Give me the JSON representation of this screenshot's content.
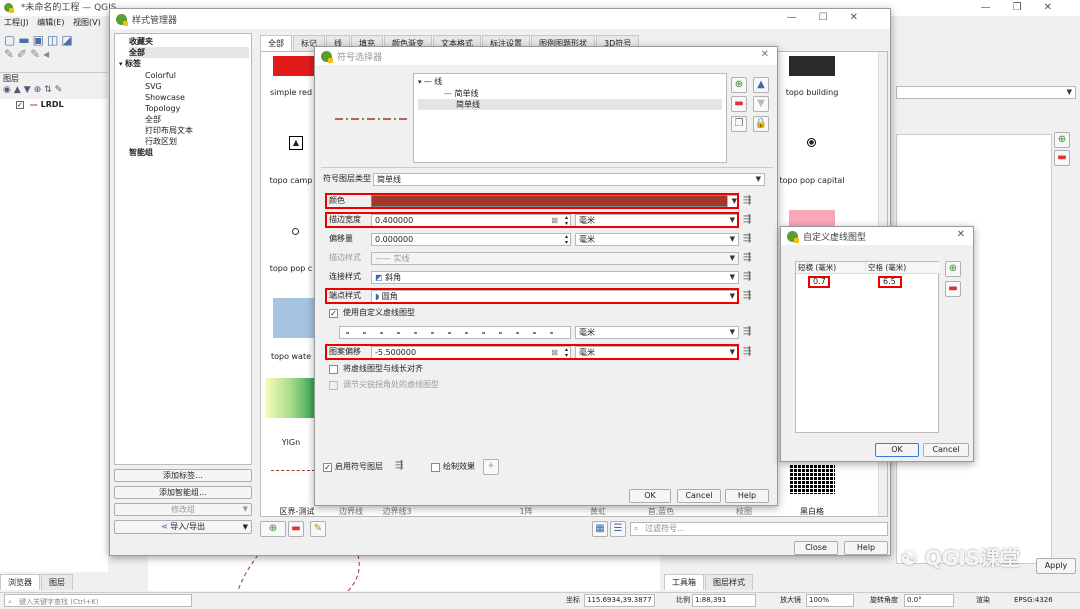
{
  "main": {
    "title": "*未命名的工程 — QGIS",
    "menu": [
      "工程(J)",
      "编辑(E)",
      "视图(V)"
    ],
    "layers_panel": {
      "title": "图层",
      "layer_name": "LRDL"
    },
    "bottom_tabs": [
      "浏览器",
      "图层"
    ],
    "search_placeholder": "键入关键字查找 (Ctrl+K)",
    "status": {
      "coord_label": "坐标",
      "coord_value": "115.6934,39.3877",
      "scale_label": "比例",
      "scale_value": "1:88,391",
      "magnifier_label": "放大镜",
      "magnifier_value": "100%",
      "rotation_label": "旋转角度",
      "rotation_value": "0.0°",
      "render_label": "渲染",
      "crs": "EPSG:4326"
    },
    "right_tabs": [
      "工具箱",
      "图层样式"
    ],
    "apply": "Apply"
  },
  "style_manager": {
    "title": "样式管理器",
    "tree": {
      "favorites": "收藏夹",
      "all": "全部",
      "tags": "标签",
      "tag_items": [
        "Colorful",
        "SVG",
        "Showcase",
        "Topology",
        "全部",
        "打印布局文本",
        "行政区划"
      ],
      "smart": "智能组"
    },
    "buttons": {
      "add_tag": "添加标签…",
      "add_smart": "添加智能组…",
      "modify": "修改组",
      "import_export": "导入/导出",
      "close": "Close",
      "help": "Help"
    },
    "tabs": [
      "全部",
      "标记",
      "线",
      "填充",
      "颜色渐变",
      "文本格式",
      "标注设置",
      "图例图题形状",
      "3D符号"
    ],
    "symbols": [
      "simple red",
      "topo camp",
      "topo pop c",
      "topo wate",
      "YlGn",
      "区界-测试",
      "边界线",
      "边界线3",
      "1阵",
      "黄虹",
      "首,蓝色",
      "枝图",
      "topo building",
      "topo pop capital",
      "黑白格"
    ],
    "filter_placeholder": "过滤符号…"
  },
  "symbol_selector": {
    "title": "符号选择器",
    "tree": {
      "root": "线",
      "items": [
        "简单线",
        "简单线"
      ]
    },
    "layer_type_label": "符号图层类型",
    "layer_type_value": "简单线",
    "color_label": "颜色",
    "color_value": "#a0382b",
    "stroke_width_label": "描边宽度",
    "stroke_width_value": "0.400000",
    "stroke_width_unit": "毫米",
    "offset_label": "偏移量",
    "offset_value": "0.000000",
    "offset_unit": "毫米",
    "stroke_style_label": "描边样式",
    "stroke_style_value": "实线",
    "join_style_label": "连接样式",
    "join_style_value": "斜角",
    "cap_style_label": "端点样式",
    "cap_style_value": "圆角",
    "custom_dash_label": "使用自定义虚线图型",
    "custom_dash_unit": "毫米",
    "pattern_offset_label": "图案偏移",
    "pattern_offset_value": "-5.500000",
    "pattern_offset_unit": "毫米",
    "align_label": "将虚线图型与线长对齐",
    "adjust_label": "调节尖锐拐角处的虚线图型",
    "enable_label": "启用符号图层",
    "effects_label": "绘制效果",
    "ok": "OK",
    "cancel": "Cancel",
    "help": "Help"
  },
  "dash_dialog": {
    "title": "自定义虚线图型",
    "col_dash": "短横 (毫米)",
    "col_space": "空格 (毫米)",
    "dash_value": "0.7",
    "space_value": "6.5",
    "ok": "OK",
    "cancel": "Cancel"
  },
  "watermark": "QGIS课堂",
  "colors": {
    "accent_red": "#e00000",
    "line_color": "#a0382b"
  }
}
